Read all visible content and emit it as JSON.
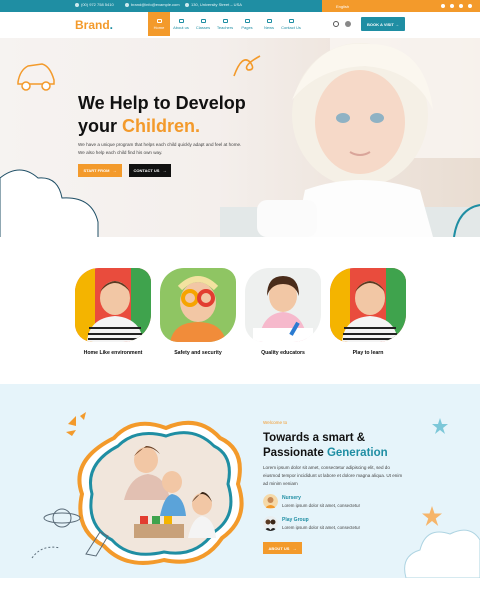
{
  "topbar": {
    "phone": "(00) 972 758 5410",
    "email": "brand@info@example.com",
    "address": "130, University Street – USA",
    "language": "English"
  },
  "brand": {
    "name": "Brand",
    "dot": "."
  },
  "nav": {
    "items": [
      {
        "label": "Home",
        "active": true
      },
      {
        "label": "About us",
        "active": false
      },
      {
        "label": "Classes",
        "active": false
      },
      {
        "label": "Teachers",
        "active": false
      },
      {
        "label": "Pages",
        "active": false
      },
      {
        "label": "News",
        "active": false
      },
      {
        "label": "Contact Us",
        "active": false
      }
    ],
    "cta": "BOOK A VISIT"
  },
  "hero": {
    "title_line1": "We Help to Develop",
    "title_line2_prefix": "your",
    "title_line2_accent": "Children.",
    "text_line1": "We have a unique program that helps each child quickly adapt and feel at home.",
    "text_line2": "We also help each child find his own way.",
    "primary_button": "START FROM",
    "secondary_button": "CONTACT US"
  },
  "features": [
    {
      "caption": "Home Like environment"
    },
    {
      "caption": "Safety and security"
    },
    {
      "caption": "Quality educators"
    },
    {
      "caption": "Play to learn"
    }
  ],
  "about": {
    "eyebrow": "Welcome to",
    "title_line1": "Towards a smart &",
    "title_line2_prefix": "Passionate",
    "title_line2_accent": "Generation",
    "text": "Lorem ipsum dolor sit amet, consectetur adipiscing elit, sed do eiusmod tempor incididunt ut labore et dolore magna aliqua. Ut enim ad minim veniam",
    "programs": [
      {
        "title": "Nursery",
        "desc": "Lorem ipsum dolor sit amet, consectetur"
      },
      {
        "title": "Play Group",
        "desc": "Lorem ipsum dolor sit amet, consectetur"
      }
    ],
    "button": "ABOUT US"
  },
  "colors": {
    "primary": "#1f8ea3",
    "accent": "#f39a2b",
    "dark": "#111111",
    "about_bg": "#e6f4fa"
  }
}
